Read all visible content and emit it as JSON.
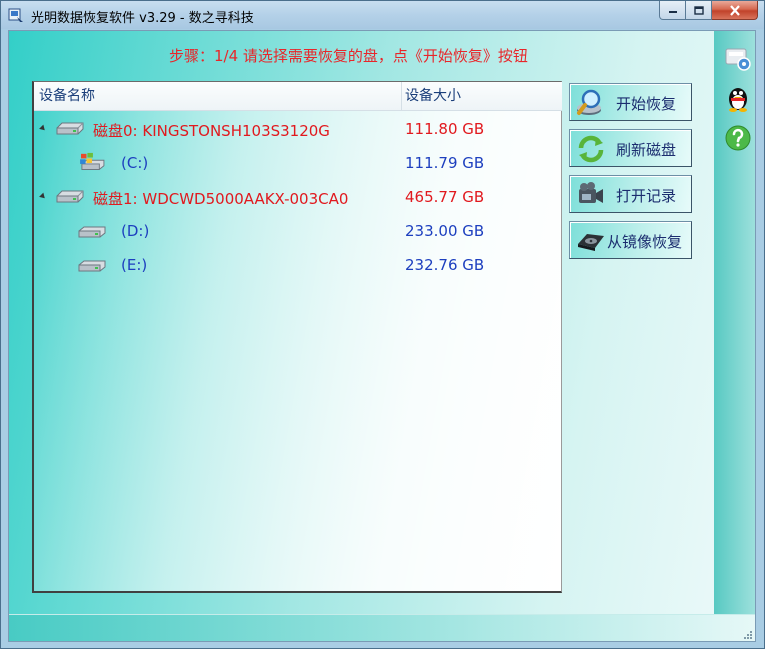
{
  "window": {
    "title": "光明数据恢复软件 v3.29 - 数之寻科技"
  },
  "step_instruction": "步骤：1/4 请选择需要恢复的盘，点《开始恢复》按钮",
  "device_list": {
    "columns": {
      "name": "设备名称",
      "size": "设备大小"
    },
    "rows": [
      {
        "label": "磁盘0: KINGSTONSH103S3120G",
        "size": "111.80 GB",
        "type": "disk",
        "expanded": true,
        "icon": "hard-disk-icon",
        "color": "#e1191e"
      },
      {
        "label": "(C:)",
        "size": "111.79 GB",
        "type": "partition",
        "icon": "windows-drive-icon",
        "color": "#1d3fbf"
      },
      {
        "label": "磁盘1: WDCWD5000AAKX-003CA0",
        "size": "465.77 GB",
        "type": "disk",
        "expanded": true,
        "icon": "hard-disk-icon",
        "color": "#e1191e"
      },
      {
        "label": "(D:)",
        "size": "233.00 GB",
        "type": "partition",
        "icon": "drive-icon",
        "color": "#1d3fbf"
      },
      {
        "label": "(E:)",
        "size": "232.76 GB",
        "type": "partition",
        "icon": "drive-icon",
        "color": "#1d3fbf"
      }
    ]
  },
  "buttons": {
    "start_recovery": "开始恢复",
    "refresh_disks": "刷新磁盘",
    "open_record": "打开记录",
    "recover_from_image": "从镜像恢复"
  },
  "side_icons": [
    "settings-icon",
    "qq-penguin-icon",
    "help-icon"
  ],
  "colors": {
    "accent_red": "#e1191e",
    "accent_blue": "#1d3fbf",
    "teal": "#33cfc8"
  }
}
